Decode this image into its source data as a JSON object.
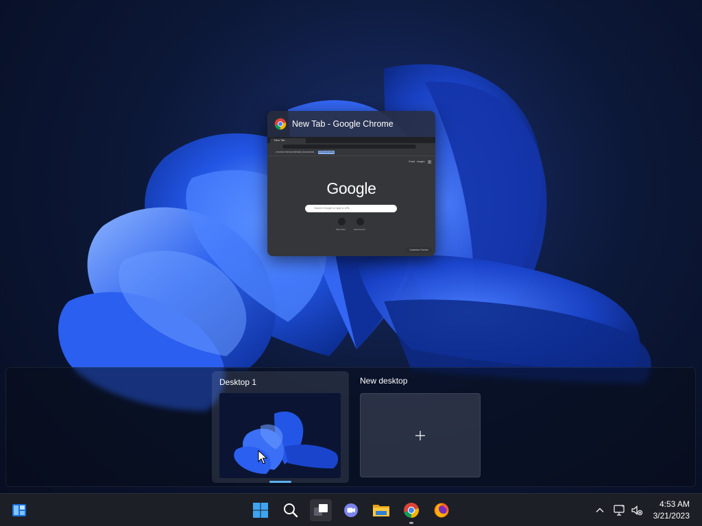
{
  "task_view": {
    "window": {
      "title": "New Tab - Google Chrome",
      "icon": "chrome-icon",
      "thumbnail": {
        "tab_title": "New Tab",
        "bookmark_text": "chrome://version/default_bookmarks",
        "bookmark_button": "All Bookmarks",
        "header_links": [
          "Gmail",
          "Images"
        ],
        "logo_text": "Google",
        "search_placeholder": "Search Google or type a URL",
        "shortcuts": [
          "Web Store",
          "Add shortcut"
        ],
        "customize_label": "Customize Chrome"
      }
    },
    "desktops": [
      {
        "label": "Desktop 1",
        "selected": true
      },
      {
        "label": "New desktop",
        "icon": "plus-icon"
      }
    ]
  },
  "taskbar": {
    "left_icon": "widgets-icon",
    "apps": [
      {
        "icon": "windows-start-icon",
        "active": false
      },
      {
        "icon": "search-icon",
        "active": false
      },
      {
        "icon": "task-view-icon",
        "active": true
      },
      {
        "icon": "teams-chat-icon",
        "active": false
      },
      {
        "icon": "file-explorer-icon",
        "active": false
      },
      {
        "icon": "chrome-icon",
        "active": false,
        "running": true
      },
      {
        "icon": "firefox-icon",
        "active": false
      }
    ],
    "tray": {
      "icons": [
        "chevron-up-icon",
        "network-icon",
        "volume-muted-icon"
      ],
      "time": "4:53 AM",
      "date": "3/21/2023"
    }
  },
  "colors": {
    "accent": "#5eb3f2",
    "taskbar_bg": "#1d1f26",
    "wallpaper_blue": "#1f55e0"
  }
}
